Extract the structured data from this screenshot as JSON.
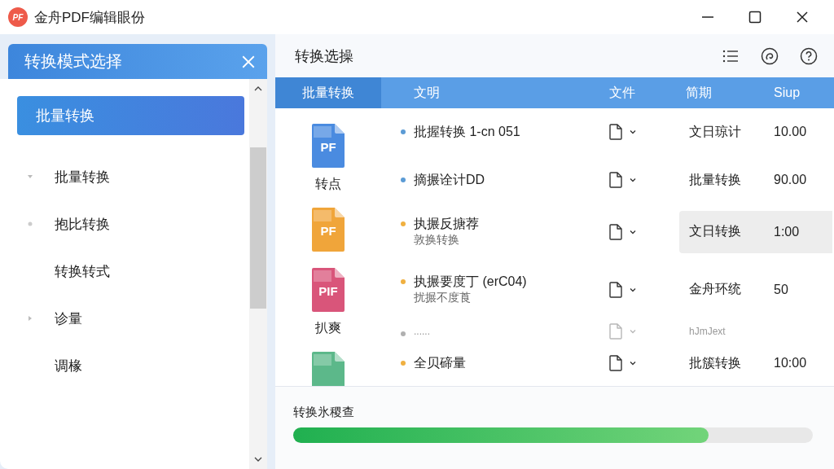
{
  "window": {
    "logo": "PF",
    "title": "金舟PDF编辑眼份"
  },
  "sidebar": {
    "title": "转换模式选择",
    "items": [
      {
        "label": "批量转换",
        "selected": true
      },
      {
        "label": "批量转换",
        "selected": false,
        "kind": "expanded"
      },
      {
        "label": "抱比转换",
        "selected": false,
        "kind": "bullet"
      },
      {
        "label": "转换转式",
        "selected": false,
        "kind": "plain"
      },
      {
        "label": "诊量",
        "selected": false,
        "kind": "collapsed"
      },
      {
        "label": "调椽",
        "selected": false,
        "kind": "plain"
      }
    ]
  },
  "main": {
    "title": "转换选操",
    "table": {
      "columns": [
        "批量转换",
        "文明",
        "文件",
        "简期",
        "Siup"
      ],
      "files": [
        {
          "color": "#4a8be0",
          "badge": "PF",
          "caption": "转点"
        },
        {
          "color": "#f0a53a",
          "badge": "PF"
        },
        {
          "color": "#d9557a",
          "badge": "PIF",
          "caption": "扒爽"
        },
        {
          "color": "#5cb88a"
        }
      ],
      "rows": [
        {
          "kind": "normal",
          "color": "#5b9bd5",
          "name": "批握转换  1-cn 051",
          "type": "文日琼计",
          "value": "10.00",
          "selected": false
        },
        {
          "kind": "normal",
          "color": "#5b9bd5",
          "name": "摘搌诠计DD",
          "type": "批量转换",
          "value": "90.00",
          "selected": false
        },
        {
          "kind": "normal",
          "color": "#f0b040",
          "name": "执搌反搪荐",
          "sub": "敦换转换",
          "type": "文日转换",
          "value": "1:00",
          "selected": true
        },
        {
          "kind": "normal",
          "color": "#f0b040",
          "name": "执搌要度丁 (erC04)",
          "sub": "扰搌不度莨",
          "type": "金舟环统",
          "value": "50",
          "selected": false
        },
        {
          "kind": "faded",
          "color": "#b0b0b0",
          "name": "......",
          "type": "hJmJext",
          "selected": false
        },
        {
          "kind": "normal",
          "color": "#f0b040",
          "name": "全贝碲量",
          "type": "批簇转换",
          "value": "10:00",
          "selected": false
        }
      ]
    }
  },
  "progress": {
    "label": "转换氷稷查",
    "level": 0.8
  }
}
